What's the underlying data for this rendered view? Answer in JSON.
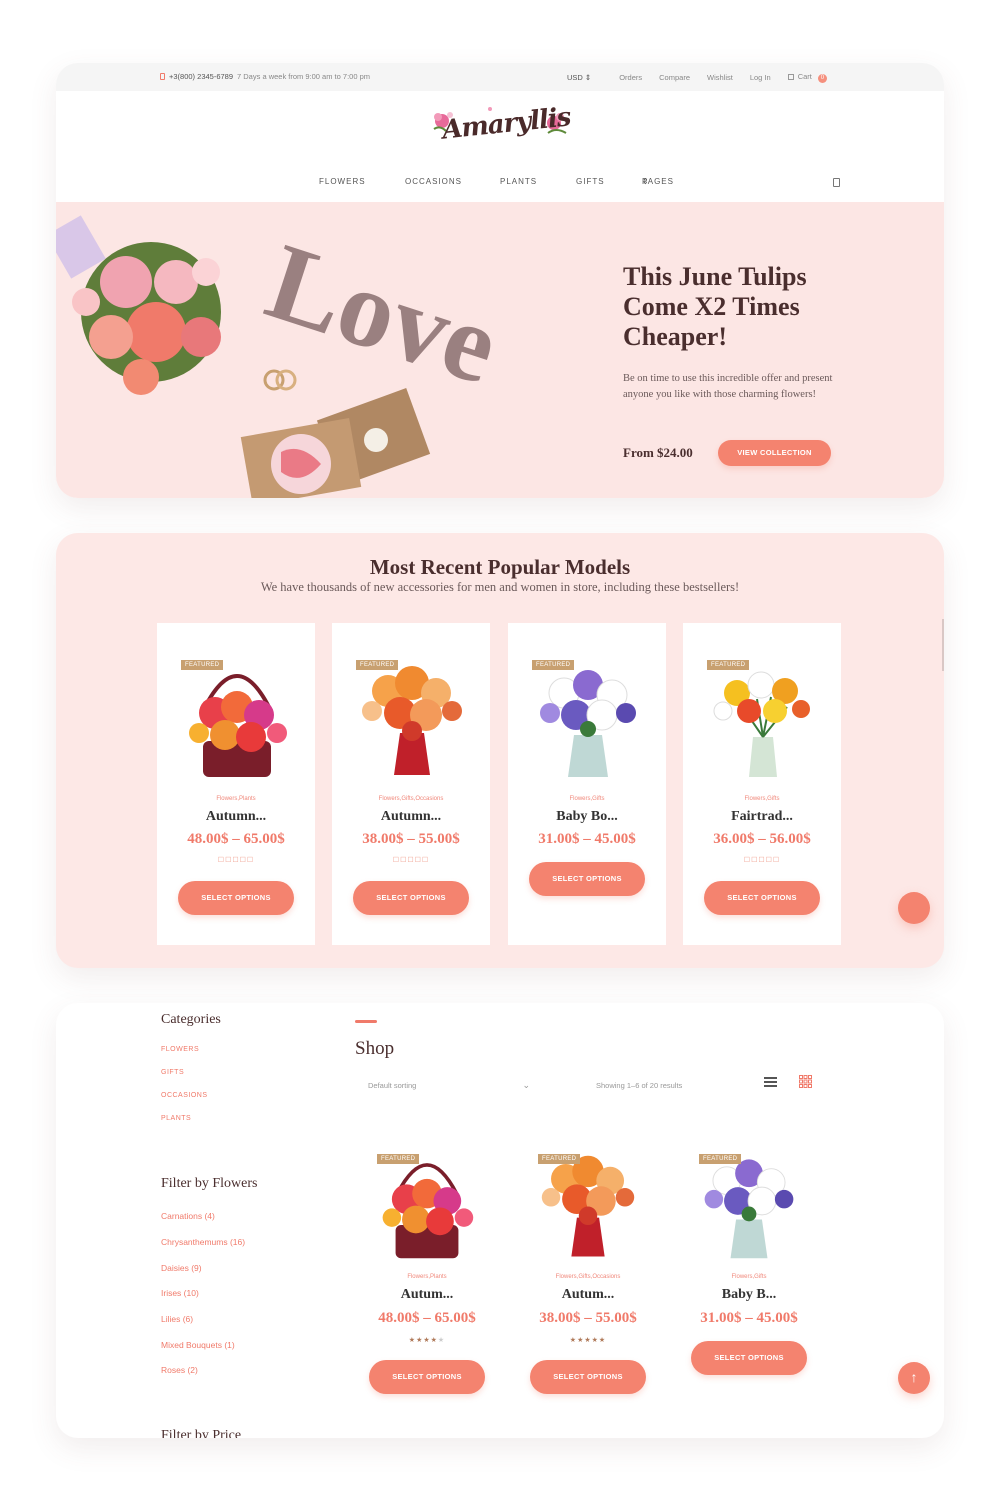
{
  "topbar": {
    "phone": "+3(800) 2345-6789",
    "hours": "7 Days a week from 9:00 am to 7:00 pm",
    "currency": "USD",
    "links": [
      "Orders",
      "Compare",
      "Wishlist",
      "Log In"
    ],
    "cart_label": "Cart",
    "cart_count": "0"
  },
  "logo_text": "Amaryllis",
  "nav": {
    "items": [
      "FLOWERS",
      "OCCASIONS",
      "PLANTS",
      "GIFTS",
      "PAGES"
    ]
  },
  "hero": {
    "title": "This June Tulips Come X2 Times Cheaper!",
    "description": "Be on time to use this incredible offer and present anyone you like with those charming flowers!",
    "price": "From $24.00",
    "button": "VIEW COLLECTION"
  },
  "popular": {
    "title": "Most Recent Popular Models",
    "subtitle": "We have thousands of new accessories for men and women in store, including these bestsellers!",
    "products": [
      {
        "badge": "FEATURED",
        "categories": "Flowers,Plants",
        "name": "Autumn...",
        "price": "48.00$ – 65.00$",
        "stars": "☐☐☐☐☐",
        "button": "SELECT OPTIONS"
      },
      {
        "badge": "FEATURED",
        "categories": "Flowers,Gifts,Occasions",
        "name": "Autumn...",
        "price": "38.00$ – 55.00$",
        "stars": "☐☐☐☐☐",
        "button": "SELECT OPTIONS"
      },
      {
        "badge": "FEATURED",
        "categories": "Flowers,Gifts",
        "name": "Baby Bo...",
        "price": "31.00$ – 45.00$",
        "stars": "",
        "button": "SELECT OPTIONS"
      },
      {
        "badge": "FEATURED",
        "categories": "Flowers,Gifts",
        "name": "Fairtrad...",
        "price": "36.00$ – 56.00$",
        "stars": "☐☐☐☐☐",
        "button": "SELECT OPTIONS"
      }
    ]
  },
  "sidebar": {
    "categories_title": "Categories",
    "categories": [
      "FLOWERS",
      "GIFTS",
      "OCCASIONS",
      "PLANTS"
    ],
    "filter_title": "Filter by Flowers",
    "filters": [
      "Carnations (4)",
      "Chrysanthemums (16)",
      "Daisies (9)",
      "Irises (10)",
      "Lilies (6)",
      "Mixed Bouquets (1)",
      "Roses (2)"
    ],
    "price_title": "Filter by Price"
  },
  "shop": {
    "title": "Shop",
    "sorting": "Default sorting",
    "results": "Showing 1–6 of 20 results",
    "products": [
      {
        "badge": "FEATURED",
        "categories": "Flowers,Plants",
        "name": "Autum...",
        "price": "48.00$ – 65.00$",
        "stars": "★★★★★",
        "rating": 4,
        "button": "SELECT OPTIONS"
      },
      {
        "badge": "FEATURED",
        "categories": "Flowers,Gifts,Occasions",
        "name": "Autum...",
        "price": "38.00$ – 55.00$",
        "stars": "★★★★★",
        "rating": 5,
        "button": "SELECT OPTIONS"
      },
      {
        "badge": "FEATURED",
        "categories": "Flowers,Gifts",
        "name": "Baby B...",
        "price": "31.00$ – 45.00$",
        "stars": "",
        "rating": 0,
        "button": "SELECT OPTIONS"
      }
    ]
  },
  "colors": {
    "accent": "#f4836f",
    "hero_bg": "#fce6e4",
    "section_bg": "#fde8e6",
    "heading": "#4a2e2e",
    "badge": "#c8a070"
  }
}
